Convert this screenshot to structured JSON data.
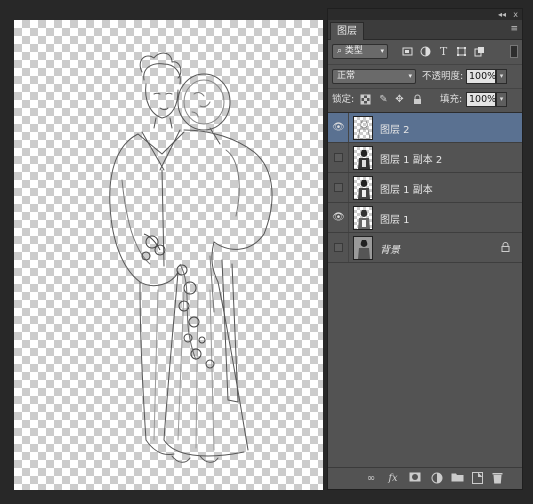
{
  "panel": {
    "collapse_arrows": "◂◂",
    "close_icon": "x",
    "tab_label": "图层",
    "menu_icon": "≡"
  },
  "filter": {
    "select_value": "类型",
    "icons": [
      "image-filter-icon",
      "adjustment-filter-icon",
      "type-filter-icon",
      "shape-filter-icon",
      "smart-object-filter-icon"
    ]
  },
  "blend": {
    "mode_value": "正常",
    "opacity_label": "不透明度:",
    "opacity_value": "100%"
  },
  "lock": {
    "label": "锁定:",
    "fill_label": "填充:",
    "fill_value": "100%"
  },
  "layers": [
    {
      "name": "图层 2",
      "visible": true,
      "selected": true,
      "locked": false,
      "italic": false
    },
    {
      "name": "图层 1 副本 2",
      "visible": false,
      "selected": false,
      "locked": false,
      "italic": false
    },
    {
      "name": "图层 1 副本",
      "visible": false,
      "selected": false,
      "locked": false,
      "italic": false
    },
    {
      "name": "图层 1",
      "visible": true,
      "selected": false,
      "locked": false,
      "italic": false
    },
    {
      "name": "背景",
      "visible": false,
      "selected": false,
      "locked": true,
      "italic": true
    }
  ],
  "colors": {
    "panel_bg": "#535353",
    "selected_row": "#5a7191",
    "workspace_bg": "#282828"
  }
}
